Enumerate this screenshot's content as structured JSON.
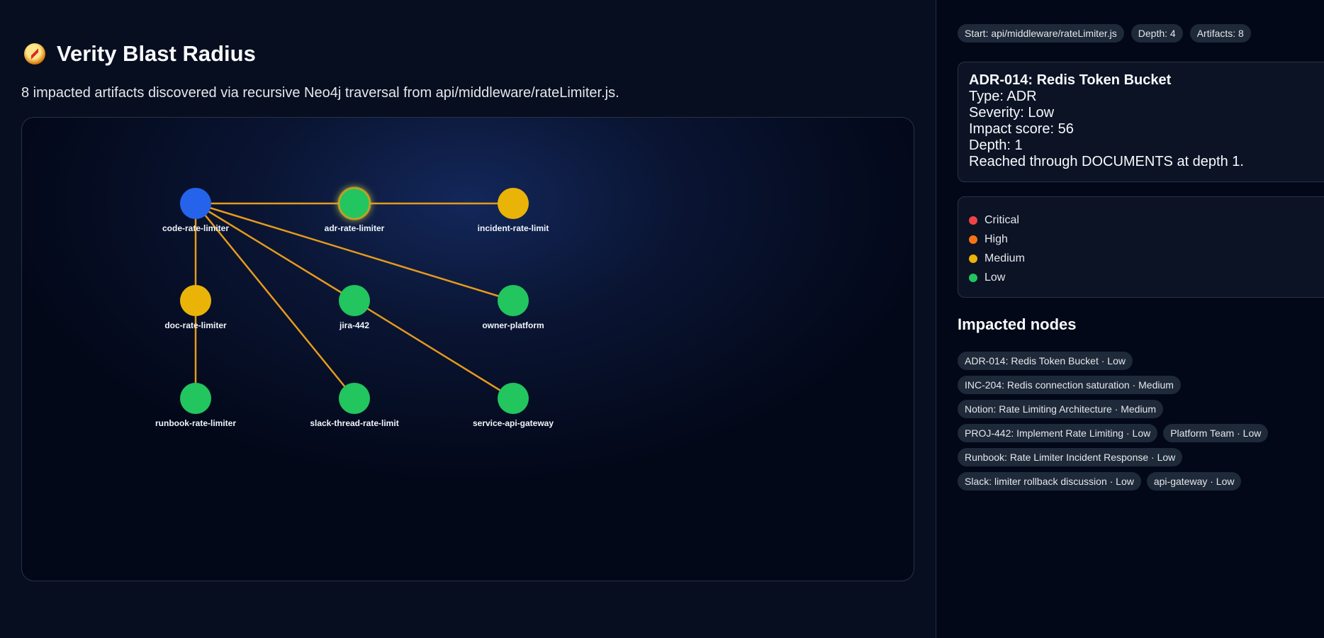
{
  "app": {
    "title": "Verity Blast Radius",
    "subtitle": "8 impacted artifacts discovered via recursive Neo4j traversal from api/middleware/rateLimiter.js."
  },
  "colors": {
    "critical": "#ef4444",
    "high": "#f97316",
    "medium": "#eab308",
    "low": "#22c55e",
    "start": "#2563eb",
    "edge": "#e59a1c"
  },
  "stats": {
    "start": "Start: api/middleware/rateLimiter.js",
    "depth": "Depth: 4",
    "artifacts": "Artifacts: 8"
  },
  "detail": {
    "title": "ADR-014: Redis Token Bucket",
    "type": "Type: ADR",
    "severity": "Severity: Low",
    "impact": "Impact score: 56",
    "depth": "Depth: 1",
    "reached": "Reached through DOCUMENTS at depth 1."
  },
  "legend": [
    {
      "label": "Critical",
      "color": "#ef4444"
    },
    {
      "label": "High",
      "color": "#f97316"
    },
    {
      "label": "Medium",
      "color": "#eab308"
    },
    {
      "label": "Low",
      "color": "#22c55e"
    }
  ],
  "impacted": {
    "title": "Impacted nodes",
    "chips": [
      "ADR-014: Redis Token Bucket · Low",
      "INC-204: Redis connection saturation · Medium",
      "Notion: Rate Limiting Architecture · Medium",
      "PROJ-442: Implement Rate Limiting · Low",
      "Platform Team · Low",
      "Runbook: Rate Limiter Incident Response · Low",
      "Slack: limiter rollback discussion · Low",
      "api-gateway · Low"
    ]
  },
  "graph": {
    "nodes": [
      {
        "id": "code-rate-limiter",
        "label": "code-rate-limiter",
        "severity": "start"
      },
      {
        "id": "adr-rate-limiter",
        "label": "adr-rate-limiter",
        "severity": "low",
        "selected": true
      },
      {
        "id": "incident-rate-limit",
        "label": "incident-rate-limit",
        "severity": "medium"
      },
      {
        "id": "doc-rate-limiter",
        "label": "doc-rate-limiter",
        "severity": "medium"
      },
      {
        "id": "jira-442",
        "label": "jira-442",
        "severity": "low"
      },
      {
        "id": "owner-platform",
        "label": "owner-platform",
        "severity": "low"
      },
      {
        "id": "runbook-rate-limiter",
        "label": "runbook-rate-limiter",
        "severity": "low"
      },
      {
        "id": "slack-thread-rate-limit",
        "label": "slack-thread-rate-limit",
        "severity": "low"
      },
      {
        "id": "service-api-gateway",
        "label": "service-api-gateway",
        "severity": "low"
      }
    ],
    "edges": [
      [
        "code-rate-limiter",
        "adr-rate-limiter"
      ],
      [
        "adr-rate-limiter",
        "incident-rate-limit"
      ],
      [
        "code-rate-limiter",
        "doc-rate-limiter"
      ],
      [
        "doc-rate-limiter",
        "runbook-rate-limiter"
      ],
      [
        "code-rate-limiter",
        "jira-442"
      ],
      [
        "code-rate-limiter",
        "owner-platform"
      ],
      [
        "code-rate-limiter",
        "slack-thread-rate-limit"
      ],
      [
        "jira-442",
        "service-api-gateway"
      ]
    ]
  }
}
